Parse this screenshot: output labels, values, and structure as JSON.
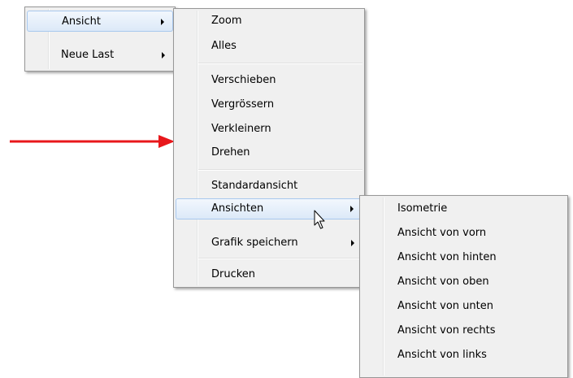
{
  "menu1": {
    "items": [
      {
        "label": "Ansicht",
        "submenu": true
      },
      {
        "label": "Neue Last",
        "submenu": true
      }
    ]
  },
  "menu2": {
    "items": [
      {
        "label": "Zoom"
      },
      {
        "label": "Alles"
      },
      {
        "label": "Verschieben"
      },
      {
        "label": "Vergrössern"
      },
      {
        "label": "Verkleinern"
      },
      {
        "label": "Drehen"
      },
      {
        "label": "Standardansicht"
      },
      {
        "label": "Ansichten",
        "submenu": true
      },
      {
        "label": "Grafik speichern",
        "submenu": true
      },
      {
        "label": "Drucken"
      }
    ]
  },
  "menu3": {
    "items": [
      {
        "label": "Isometrie"
      },
      {
        "label": "Ansicht von vorn"
      },
      {
        "label": "Ansicht von hinten"
      },
      {
        "label": "Ansicht von oben"
      },
      {
        "label": "Ansicht von unten"
      },
      {
        "label": "Ansicht von rechts"
      },
      {
        "label": "Ansicht von links"
      }
    ]
  },
  "annotations": {
    "pointer_arrow_color": "#e8171b",
    "cursor": "mouse-pointer-icon"
  }
}
